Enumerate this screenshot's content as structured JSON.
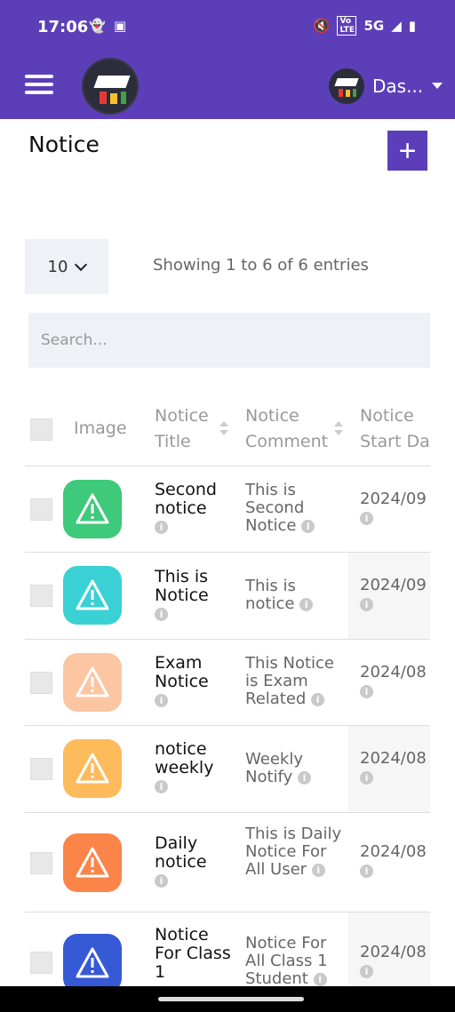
{
  "status_bar": {
    "time": "17:06",
    "network": "5G",
    "volte": "Vo LTE"
  },
  "app_bar": {
    "user_name": "Das..."
  },
  "page": {
    "title": "Notice",
    "add_label": "+"
  },
  "controls": {
    "page_length": "10",
    "info": "Showing 1 to 6 of 6 entries",
    "search_placeholder": "Search..."
  },
  "table": {
    "columns": [
      {
        "label": "Image"
      },
      {
        "label": "Notice Title"
      },
      {
        "label": "Notice Comment"
      },
      {
        "label": "Notice Start Da"
      }
    ],
    "rows": [
      {
        "title": "Second notice",
        "comment": "This is Second Notice",
        "date": "2024/09",
        "color": "#3fc97a"
      },
      {
        "title": "This is Notice",
        "comment": "This is notice",
        "date": "2024/09",
        "color": "#3ad1d4"
      },
      {
        "title": "Exam Notice",
        "comment": "This Notice is Exam Related",
        "date": "2024/08",
        "color": "#fcc6a2"
      },
      {
        "title": "notice weekly",
        "comment": "Weekly Notify",
        "date": "2024/08",
        "color": "#fdbb5c"
      },
      {
        "title": "Daily notice",
        "comment": "This is Daily Notice For All User",
        "date": "2024/08",
        "color": "#fb8549"
      },
      {
        "title": "Notice For Class 1",
        "comment": "Notice For All Class 1 Student",
        "date": "2024/08",
        "color": "#3659d6"
      }
    ]
  },
  "colors": {
    "accent": "#5c3fb8"
  }
}
